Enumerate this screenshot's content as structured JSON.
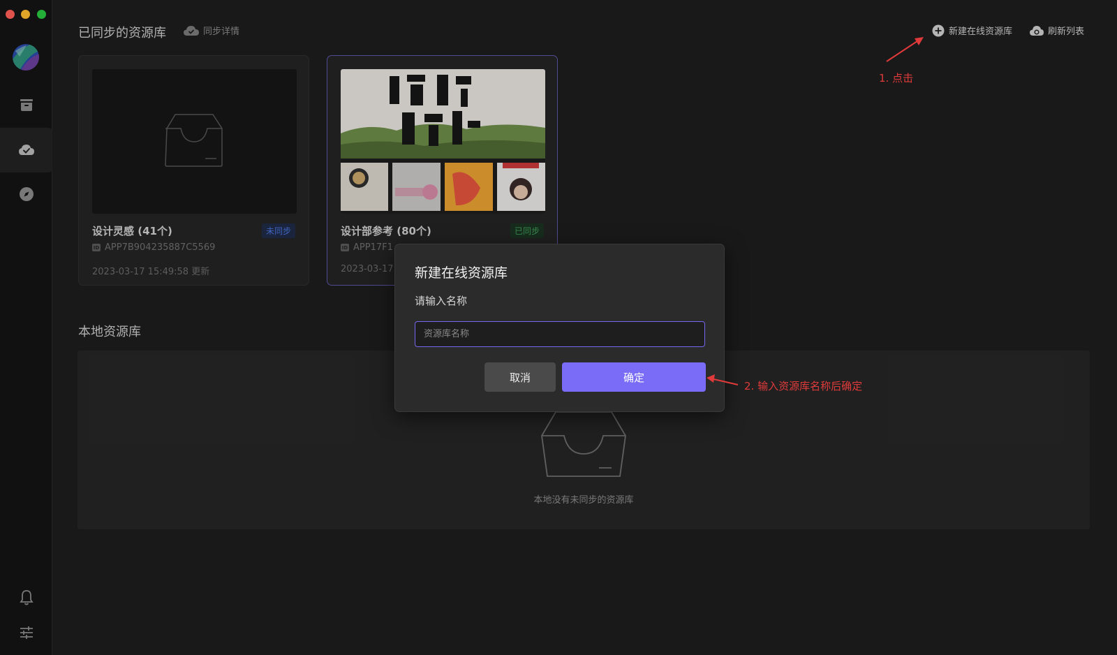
{
  "synced_section": {
    "title": "已同步的资源库",
    "sync_detail_label": "同步详情"
  },
  "top_actions": {
    "new_online_library": "新建在线资源库",
    "refresh_list": "刷新列表"
  },
  "libraries": [
    {
      "name": "设计灵感 (41个)",
      "status": "未同步",
      "id": "APP7B904235887C5569",
      "updated": "2023-03-17 15:49:58 更新",
      "thumbnail": "empty-box-icon"
    },
    {
      "name": "设计部参考 (80个)",
      "status": "已同步",
      "id": "APP17F1",
      "updated": "2023-03-17",
      "thumbnail": "image-collage"
    }
  ],
  "local_section": {
    "title": "本地资源库",
    "empty_text": "本地没有未同步的资源库"
  },
  "dialog": {
    "title": "新建在线资源库",
    "label": "请输入名称",
    "input_placeholder": "资源库名称",
    "input_value": "",
    "cancel_label": "取消",
    "confirm_label": "确定"
  },
  "annotations": {
    "step1": "1. 点击",
    "step2": "2. 输入资源库名称后确定"
  },
  "colors": {
    "accent": "#7a6cf7",
    "annotation_red": "#e03a3a",
    "unsynced_blue": "#4a72d9",
    "synced_green": "#3f9a58"
  }
}
